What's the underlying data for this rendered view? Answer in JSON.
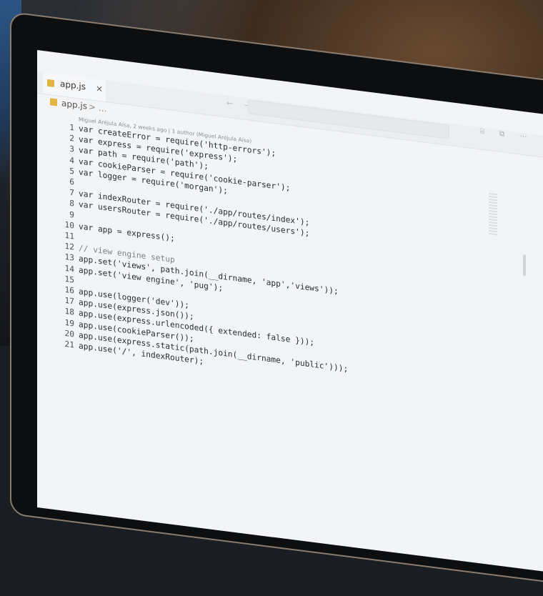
{
  "editor": {
    "tab_label": "app.js",
    "tab_close": "×",
    "breadcrumb_file": "app.js",
    "breadcrumb_sep": ">",
    "breadcrumb_more": "...",
    "blame": "Miguel Aréjula Aísa, 2 weeks ago | 1 author (Miguel Aréjula Aísa)",
    "nav_arrows": "← →",
    "top_icons": "⌸ ⧉ ⋯"
  },
  "code_lines": [
    {
      "n": "1",
      "text": "var createError = require('http-errors');"
    },
    {
      "n": "2",
      "text": "var express = require('express');"
    },
    {
      "n": "3",
      "text": "var path = require('path');"
    },
    {
      "n": "4",
      "text": "var cookieParser = require('cookie-parser');"
    },
    {
      "n": "5",
      "text": "var logger = require('morgan');"
    },
    {
      "n": "6",
      "text": ""
    },
    {
      "n": "7",
      "text": "var indexRouter = require('./app/routes/index');"
    },
    {
      "n": "8",
      "text": "var usersRouter = require('./app/routes/users');"
    },
    {
      "n": "9",
      "text": ""
    },
    {
      "n": "10",
      "text": "var app = express();"
    },
    {
      "n": "11",
      "text": ""
    },
    {
      "n": "12",
      "text": "// view engine setup"
    },
    {
      "n": "13",
      "text": "app.set('views', path.join(__dirname, 'app','views'));"
    },
    {
      "n": "14",
      "text": "app.set('view engine', 'pug');"
    },
    {
      "n": "15",
      "text": ""
    },
    {
      "n": "16",
      "text": "app.use(logger('dev'));"
    },
    {
      "n": "17",
      "text": "app.use(express.json());"
    },
    {
      "n": "18",
      "text": "app.use(express.urlencoded({ extended: false }));"
    },
    {
      "n": "19",
      "text": "app.use(cookieParser());"
    },
    {
      "n": "20",
      "text": "app.use(express.static(path.join(__dirname, 'public')));"
    },
    {
      "n": "21",
      "text": "app.use('/', indexRouter);"
    }
  ]
}
